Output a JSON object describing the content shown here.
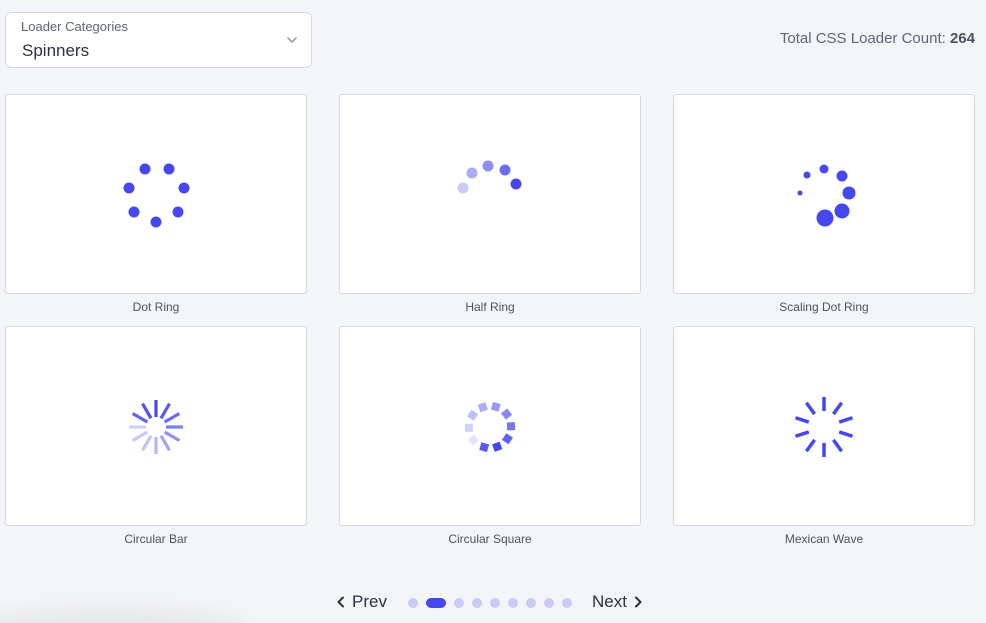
{
  "category_select": {
    "label": "Loader Categories",
    "value": "Spinners"
  },
  "total": {
    "label": "Total CSS Loader Count: ",
    "count": "264"
  },
  "colors": {
    "accent": "#4747ef",
    "accent_light": "#c9cbf6",
    "background": "#f4f5f9"
  },
  "loaders": [
    {
      "name": "Dot Ring"
    },
    {
      "name": "Half Ring"
    },
    {
      "name": "Scaling Dot Ring"
    },
    {
      "name": "Circular Bar"
    },
    {
      "name": "Circular Square"
    },
    {
      "name": "Mexican Wave"
    }
  ],
  "pagination": {
    "prev_label": "Prev",
    "next_label": "Next",
    "page_count": 9,
    "active_page": 2
  }
}
